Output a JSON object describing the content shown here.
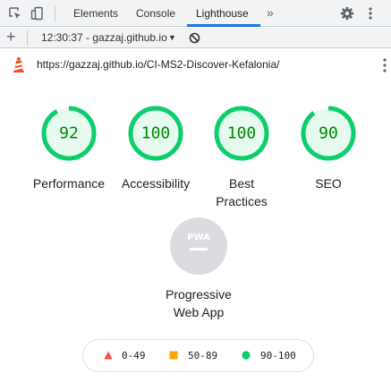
{
  "devtools": {
    "tabs": [
      {
        "label": "Elements",
        "active": false
      },
      {
        "label": "Console",
        "active": false
      },
      {
        "label": "Lighthouse",
        "active": true
      }
    ],
    "more_glyph": "»",
    "accent_color": "#1a73e8"
  },
  "toolbar": {
    "add_glyph": "+",
    "report_label": "12:30:37 - gazzaj.github.io",
    "caret_glyph": "▼"
  },
  "url": "https://gazzaj.github.io/CI-MS2-Discover-Kefalonia/",
  "scores": [
    {
      "label": "Performance",
      "value": "92",
      "score": 0.92
    },
    {
      "label": "Accessibility",
      "value": "100",
      "score": 1.0
    },
    {
      "label": "Best\nPractices",
      "label_lines": [
        "Best",
        "Practices"
      ],
      "value": "100",
      "score": 1.0
    },
    {
      "label": "SEO",
      "value": "90",
      "score": 0.9
    }
  ],
  "pwa": {
    "badge_text": "PWA",
    "label_lines": [
      "Progressive",
      "Web App"
    ]
  },
  "legend": [
    {
      "shape": "triangle",
      "color": "#ff4e42",
      "range": "0-49"
    },
    {
      "shape": "square",
      "color": "#ffa400",
      "range": "50-89"
    },
    {
      "shape": "circle",
      "color": "#0cce6b",
      "range": "90-100"
    }
  ],
  "colors": {
    "pass": "#0cce6b",
    "pass_text": "#008800",
    "pass_fill": "#e6faf0",
    "pwa_gray": "#dadce0",
    "lighthouse_orange": "#f44b21"
  }
}
